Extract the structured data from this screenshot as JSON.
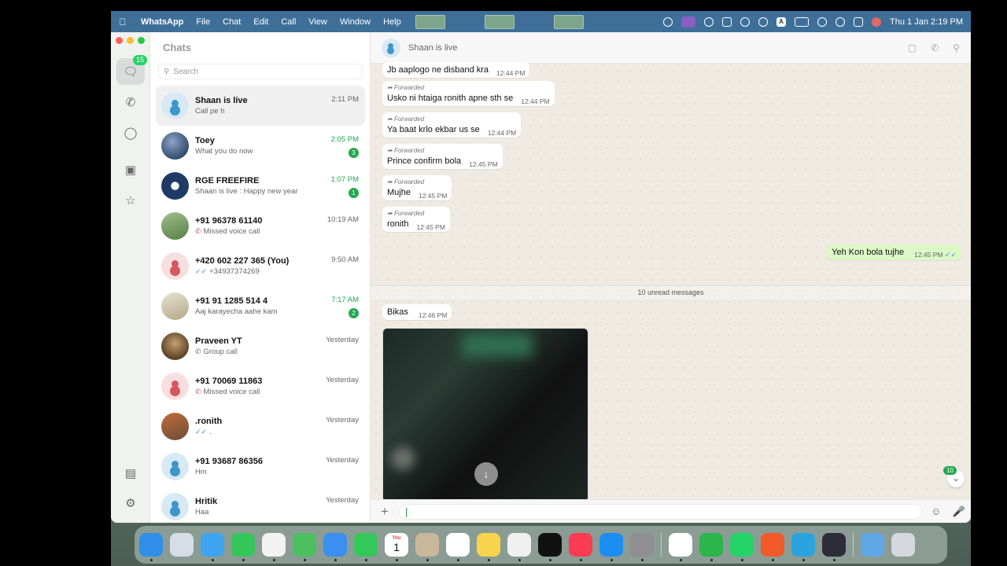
{
  "menubar": {
    "app": "WhatsApp",
    "items": [
      "File",
      "Chat",
      "Edit",
      "Call",
      "View",
      "Window",
      "Help"
    ],
    "clock": "Thu 1 Jan  2:19 PM"
  },
  "rail": {
    "chats_badge": "15"
  },
  "chats": {
    "title": "Chats",
    "search_placeholder": "Search",
    "rows": [
      {
        "name": "Shaan is live",
        "msg": "Call pe h",
        "time": "2:11 PM",
        "unread": "",
        "status": "",
        "avatar": "av-def",
        "time_green": false,
        "selected": true
      },
      {
        "name": "Toey",
        "msg": "What you do now",
        "time": "2:05 PM",
        "unread": "3",
        "status": "",
        "avatar": "av-photo1",
        "time_green": true
      },
      {
        "name": "RGE FREEFIRE",
        "msg": "Shaan is live : Happy new year",
        "time": "1:07 PM",
        "unread": "1",
        "status": "",
        "avatar": "av-photo2",
        "time_green": true
      },
      {
        "name": "+91 96378 61140",
        "msg": "Missed voice call",
        "time": "10:19 AM",
        "unread": "",
        "status": "missed",
        "avatar": "av-photo3",
        "time_green": false
      },
      {
        "name": "+420 602 227 365 (You)",
        "msg": "+34937374269",
        "time": "9:50 AM",
        "unread": "",
        "status": "read",
        "avatar": "av-pink",
        "time_green": false
      },
      {
        "name": "+91 91 1285 514 4",
        "msg": "Aaj karayecha aahe kam",
        "time": "7:17 AM",
        "unread": "2",
        "status": "",
        "avatar": "av-photo4",
        "time_green": true
      },
      {
        "name": "Praveen YT",
        "msg": "Group call",
        "time": "Yesterday",
        "unread": "",
        "status": "call",
        "avatar": "av-photo5",
        "time_green": false
      },
      {
        "name": "+91 70069 11863",
        "msg": "Missed voice call",
        "time": "Yesterday",
        "unread": "",
        "status": "missed",
        "avatar": "av-pink",
        "time_green": false
      },
      {
        "name": ".ronith",
        "msg": ".",
        "time": "Yesterday",
        "unread": "",
        "status": "read",
        "avatar": "av-photo6",
        "time_green": false
      },
      {
        "name": "+91 93687 86356",
        "msg": "Hm",
        "time": "Yesterday",
        "unread": "",
        "status": "",
        "avatar": "av-def",
        "time_green": false
      },
      {
        "name": "Hritik",
        "msg": "Haa",
        "time": "Yesterday",
        "unread": "",
        "status": "",
        "avatar": "av-def",
        "time_green": false
      }
    ]
  },
  "conversation": {
    "title": "Shaan is live",
    "forwarded_label": "Forwarded",
    "messages": [
      {
        "text": "Jb aaplogo ne disband kra",
        "time": "12:44 PM",
        "forwarded": false
      },
      {
        "text": "Usko ni htaiga ronith apne sth se",
        "time": "12:44 PM",
        "forwarded": true
      },
      {
        "text": "Ya baat krlo ekbar us se",
        "time": "12:44 PM",
        "forwarded": true
      },
      {
        "text": "Prince confirm bola",
        "time": "12:45 PM",
        "forwarded": true
      },
      {
        "text": "Mujhe",
        "time": "12:45 PM",
        "forwarded": true
      },
      {
        "text": "ronith",
        "time": "12:45 PM",
        "forwarded": true
      }
    ],
    "outgoing": {
      "text": "Yeh Kon bola tujhe",
      "time": "12:45 PM"
    },
    "unread_divider": "10 unread messages",
    "latest": {
      "text": "Bikas",
      "time": "12:46 PM"
    },
    "scroll_badge": "10"
  },
  "dock": {
    "calendar_month": "Thu",
    "calendar_day": "1",
    "apps": [
      "finder",
      "launchpad",
      "safari",
      "messages",
      "photos",
      "maps",
      "mail",
      "facetime",
      "calendar",
      "contacts",
      "reminders",
      "notes",
      "freeform",
      "apple-tv",
      "music",
      "app-store",
      "system-settings",
      "chrome",
      "screen-recorder",
      "whatsapp",
      "brave",
      "telegram",
      "obs",
      "downloads",
      "trash"
    ]
  }
}
